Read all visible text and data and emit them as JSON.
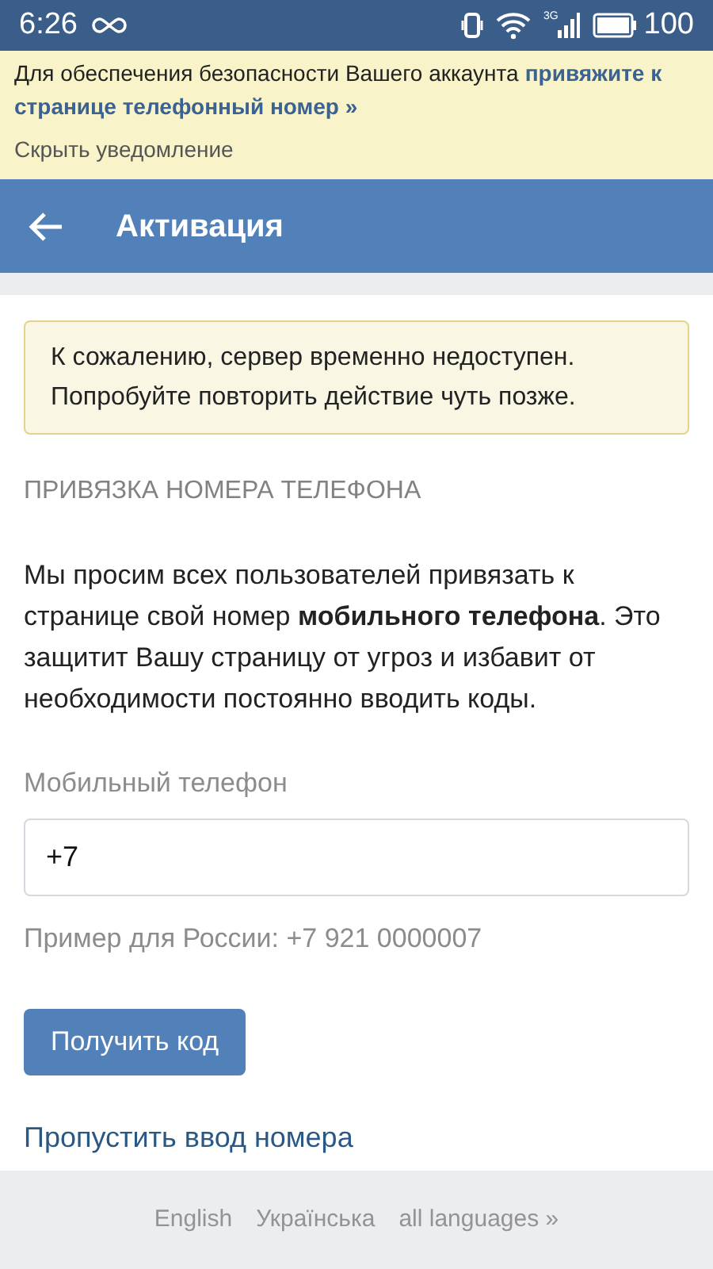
{
  "status_bar": {
    "time": "6:26",
    "network": "3G",
    "battery": "100"
  },
  "notice": {
    "text": "Для обеспечения безопасности Вашего аккаунта",
    "link_lines": [
      "привяжите к",
      "странице телефонный номер »"
    ],
    "hide": "Скрыть уведомление"
  },
  "header": {
    "title": "Активация"
  },
  "error": {
    "lines": [
      "К сожалению, сервер временно недоступен.",
      "Попробуйте повторить действие чуть позже."
    ]
  },
  "section": {
    "title": "ПРИВЯЗКА НОМЕРА ТЕЛЕФОНА",
    "text": "Мы просим всех пользователей привязать к странице свой номер **мобильного телефона**. Это защитит Вашу страницу от угроз и избавит от необходимости постоянно вводить коды."
  },
  "phone": {
    "label": "Мобильный телефон",
    "value": "+7",
    "hint": "Пример для России: +7 921 0000007"
  },
  "submit": "Получить код",
  "skip": "Пропустить ввод номера",
  "languages": [
    "English",
    "Українська",
    "all languages »"
  ]
}
